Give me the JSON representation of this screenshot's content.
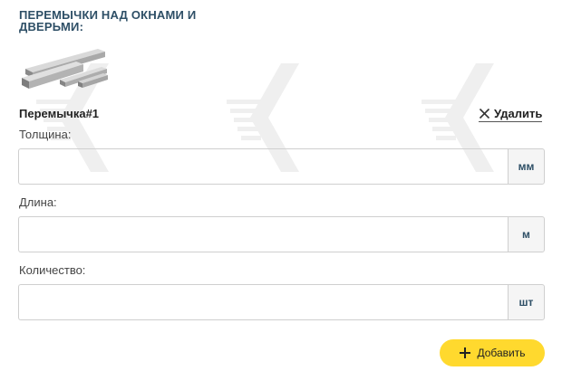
{
  "section": {
    "title": "ПЕРЕМЫЧКИ НАД ОКНАМИ И ДВЕРЬМИ:"
  },
  "product": {
    "image_alt": "concrete-lintels-image"
  },
  "item": {
    "title": "Перемычка#1",
    "remove_label": "Удалить"
  },
  "fields": {
    "thickness": {
      "label": "Толщина:",
      "value": "",
      "unit": "мм"
    },
    "length": {
      "label": "Длина:",
      "value": "",
      "unit": "м"
    },
    "quantity": {
      "label": "Количество:",
      "value": "",
      "unit": "шт"
    }
  },
  "actions": {
    "add_label": "Добавить"
  },
  "colors": {
    "accent": "#ffd92e",
    "title": "#2e4f66",
    "watermark": "#eeeeee"
  },
  "icons": {
    "remove": "close-icon",
    "add": "plus-icon"
  }
}
